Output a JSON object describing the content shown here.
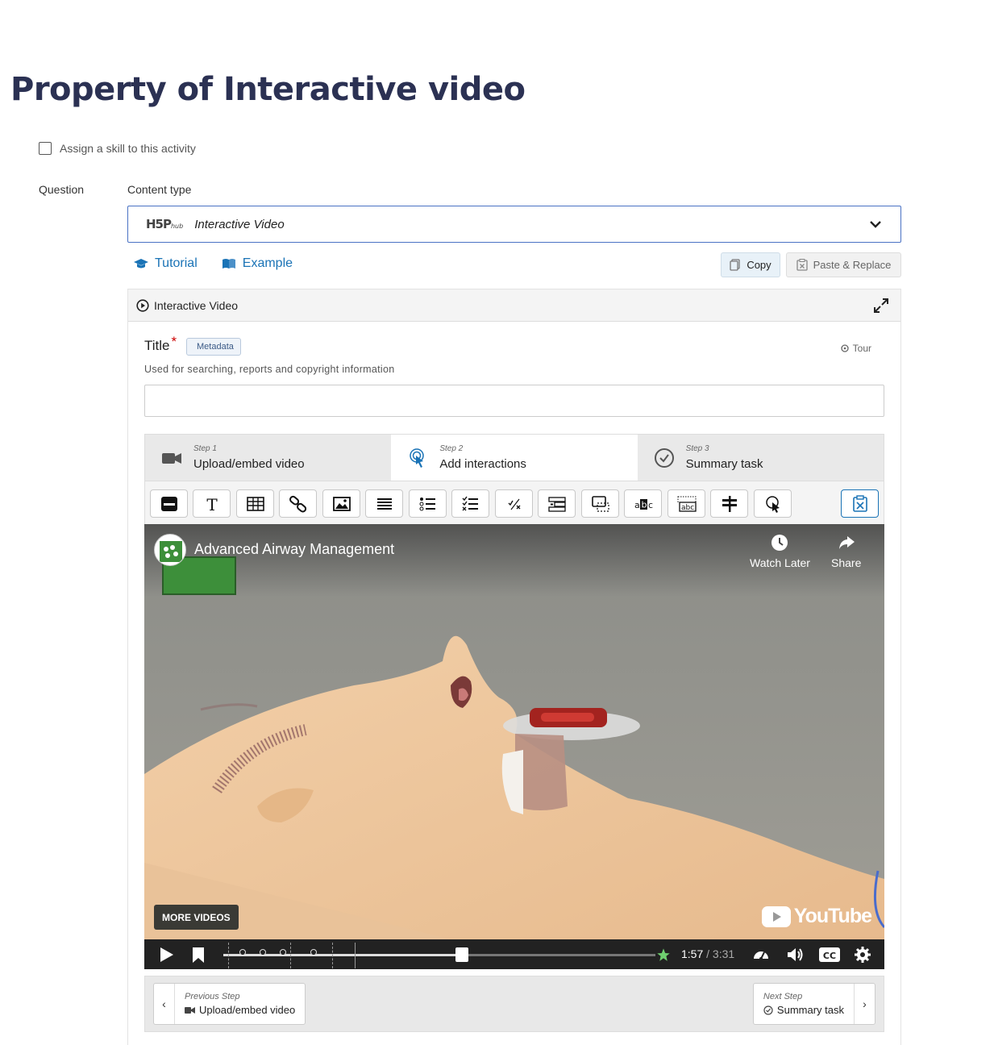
{
  "page": {
    "title": "Property of Interactive video"
  },
  "skill": {
    "label": "Assign a skill to this activity",
    "checked": false
  },
  "question": {
    "label": "Question"
  },
  "content_type": {
    "label": "Content type",
    "logo_text": "H5P",
    "logo_sub": "hub",
    "value": "Interactive Video",
    "icon": "chevron-down-icon"
  },
  "links": {
    "tutorial": "Tutorial",
    "example": "Example"
  },
  "clipboard": {
    "copy": "Copy",
    "paste_replace": "Paste & Replace"
  },
  "editor": {
    "header": "Interactive Video",
    "title_label": "Title",
    "required_mark": "*",
    "metadata": "Metadata",
    "tour": "Tour",
    "title_description": "Used for searching, reports and copyright information",
    "title_value": ""
  },
  "steps": [
    {
      "num": "Step 1",
      "name": "Upload/embed video",
      "icon": "video-camera-icon",
      "active": false
    },
    {
      "num": "Step 2",
      "name": "Add interactions",
      "icon": "touch-icon",
      "active": true
    },
    {
      "num": "Step 3",
      "name": "Summary task",
      "icon": "check-circle-icon",
      "active": false
    }
  ],
  "toolbar": {
    "tools": [
      "label-tool",
      "text-tool",
      "table-tool",
      "link-tool",
      "image-tool",
      "statements-tool",
      "single-choice-tool",
      "multiple-choice-tool",
      "true-false-tool",
      "fill-blanks-tool",
      "drag-drop-tool",
      "mark-words-tool",
      "drag-text-tool",
      "crossroads-tool",
      "navigation-hotspot-tool"
    ],
    "paste_tool": "paste-interaction-tool"
  },
  "video": {
    "title": "Advanced Airway Management",
    "watch_later": "Watch Later",
    "share": "Share",
    "more_videos": "MORE VIDEOS",
    "youtube": "YouTube",
    "current_time": "1:57",
    "separator": " / ",
    "duration": "3:31",
    "progress": 0.553
  },
  "step_nav": {
    "previous_label": "Previous Step",
    "previous_name": "Upload/embed video",
    "next_label": "Next Step",
    "next_name": "Summary task"
  },
  "colors": {
    "title": "#2b3153",
    "link": "#1a73b6",
    "accent_border": "#4a72c4"
  }
}
